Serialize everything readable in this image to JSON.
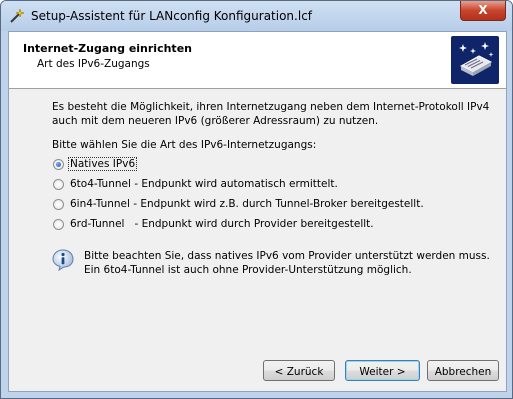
{
  "window": {
    "title": "Setup-Assistent für LANconfig Konfiguration.lcf",
    "close_label": "X"
  },
  "header": {
    "title": "Internet-Zugang einrichten",
    "subtitle": "Art des IPv6-Zugangs"
  },
  "content": {
    "intro_line1": "Es besteht die Möglichkeit, ihren Internetzugang neben dem Internet-Protokoll IPv4",
    "intro_line2": "auch mit dem neueren IPv6 (größerer Adressraum) zu nutzen.",
    "prompt": "Bitte wählen Sie die Art des IPv6-Internetzugangs:",
    "options": [
      {
        "label": "Natives IPv6",
        "selected": true
      },
      {
        "label": "6to4-Tunnel - Endpunkt wird automatisch ermittelt.",
        "selected": false
      },
      {
        "label": "6in4-Tunnel - Endpunkt wird z.B. durch Tunnel-Broker bereitgestellt.",
        "selected": false
      },
      {
        "label": "6rd-Tunnel   - Endpunkt wird durch Provider bereitgestellt.",
        "selected": false
      }
    ],
    "info_line1": "Bitte beachten Sie, dass natives IPv6 vom Provider unterstützt werden muss.",
    "info_line2": "Ein 6to4-Tunnel ist auch ohne Provider-Unterstützung möglich."
  },
  "buttons": {
    "back": "< Zurück",
    "next": "Weiter >",
    "cancel": "Abbrechen"
  }
}
